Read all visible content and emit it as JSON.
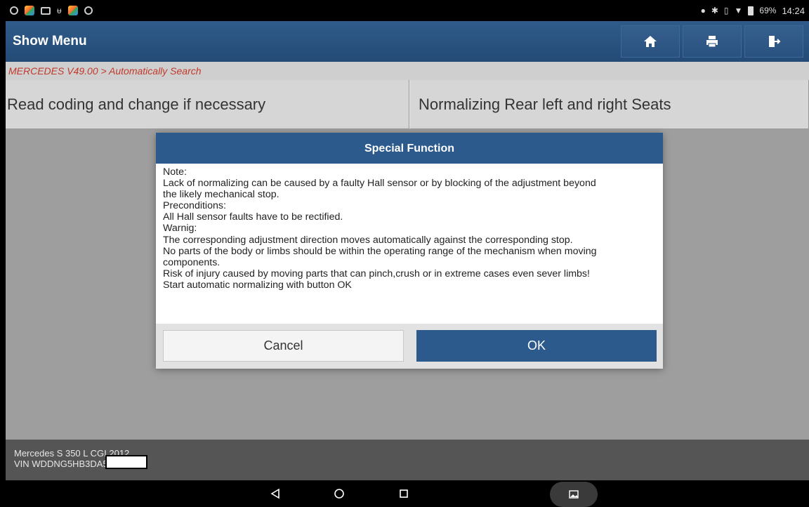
{
  "status_bar": {
    "left_icons": [
      "timer-icon",
      "app-launcher-icon",
      "screenshot-icon",
      "usb-icon",
      "app-launcher-icon",
      "search-icon"
    ],
    "right_icons": [
      "location-icon",
      "bluetooth-icon",
      "vibrate-icon",
      "wifi-icon",
      "battery-icon"
    ],
    "battery": "69%",
    "time": "14:24"
  },
  "header": {
    "title": "Show Menu",
    "buttons": [
      "home-icon",
      "print-icon",
      "exit-icon"
    ]
  },
  "breadcrumb": "MERCEDES V49.00 > Automatically Search",
  "menu": {
    "items": [
      {
        "label": "Read coding and change if necessary"
      },
      {
        "label": "Normalizing Rear left and right Seats"
      }
    ]
  },
  "dialog": {
    "title": "Special Function",
    "lines": [
      "Note:",
      "Lack of normalizing can be caused by a faulty Hall sensor or by blocking of the adjustment beyond",
      "the likely mechanical stop.",
      "Preconditions:",
      "All Hall sensor faults have to be rectified.",
      "Warnig:",
      "The corresponding adjustment direction moves automatically against the corresponding stop.",
      "No parts of the body or limbs should be within the operating range of the mechanism when moving",
      "components.",
      "Risk of injury caused by moving parts that can pinch,crush or in extreme cases even sever limbs!",
      "Start automatic normalizing with button OK"
    ],
    "cancel_label": "Cancel",
    "ok_label": "OK"
  },
  "footer": {
    "vehicle": "Mercedes S 350 L CGI 2012",
    "vin": "VIN WDDNG5HB3DA5"
  },
  "nav_bar": {
    "buttons": [
      "back-icon",
      "home-circle-icon",
      "recents-icon",
      "gallery-icon"
    ]
  },
  "colors": {
    "header_blue": "#2f5b8a",
    "breadcrumb_red": "#c0392b",
    "ok_blue": "#2d5a8c"
  }
}
